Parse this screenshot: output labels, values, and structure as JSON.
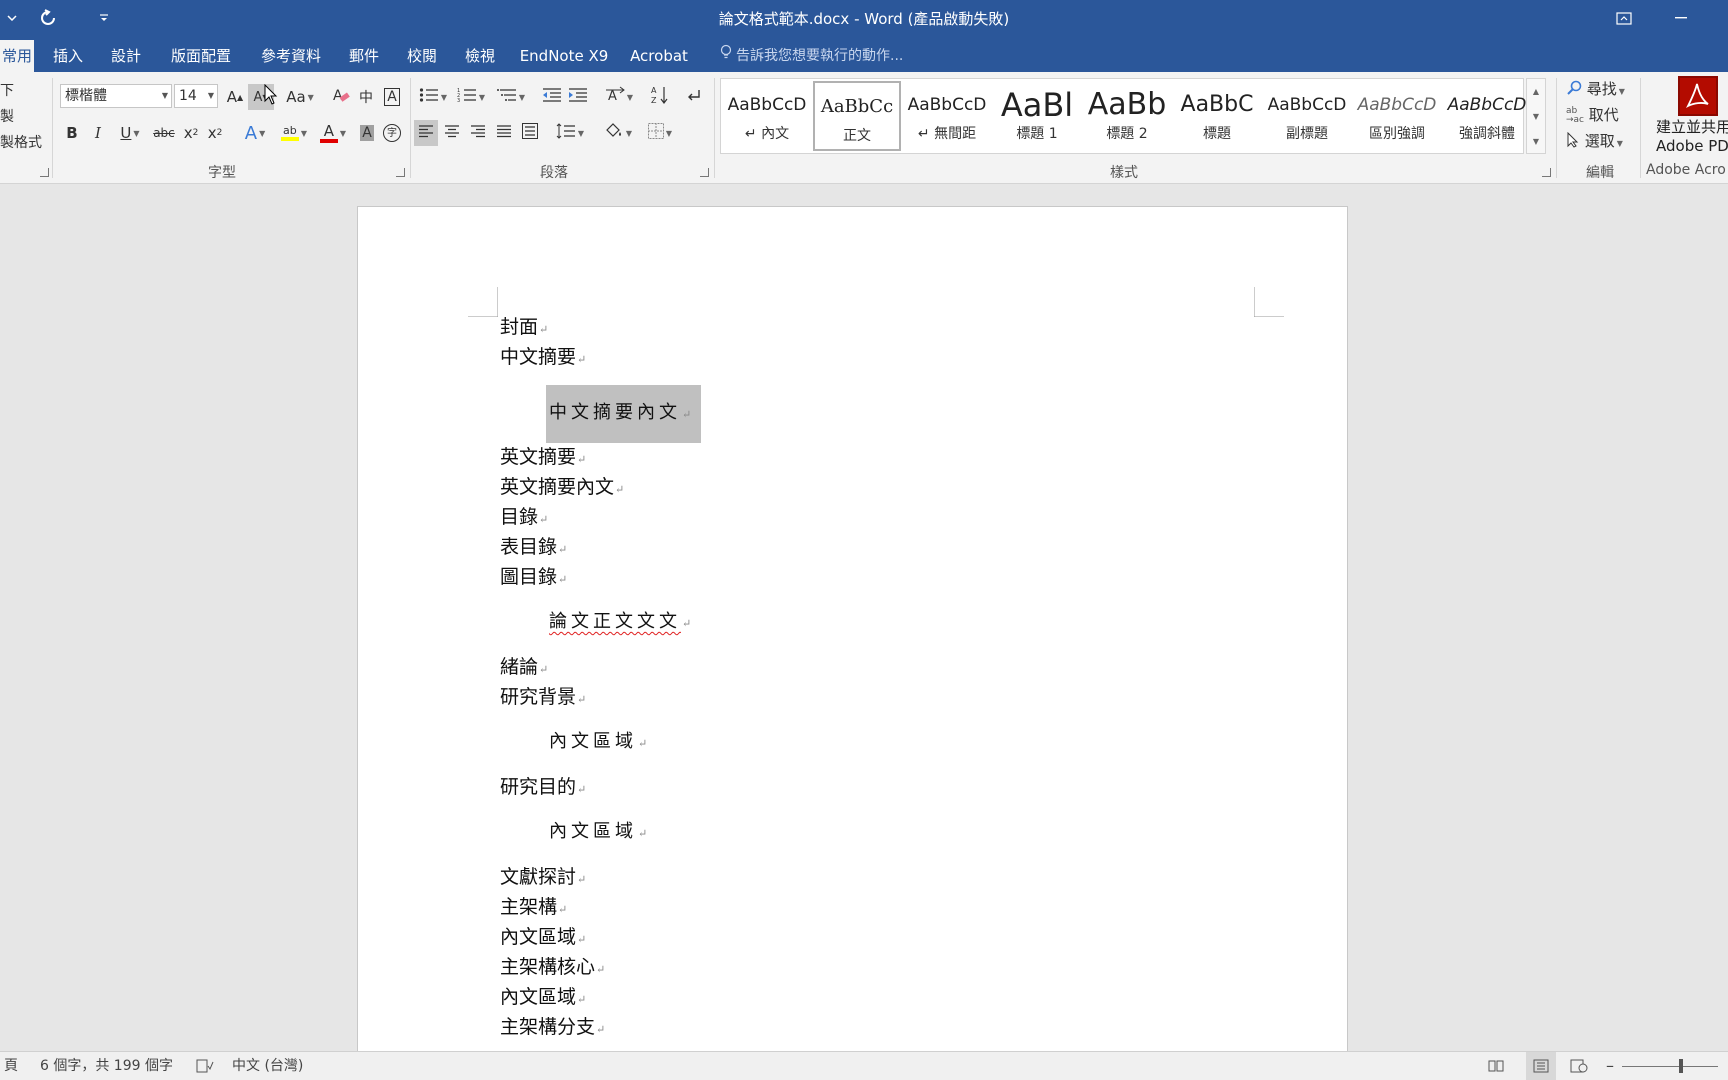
{
  "window": {
    "title": "論文格式範本.docx - Word (產品啟動失敗)"
  },
  "quick_access": {
    "dropdown_icon": "chevron-down-icon",
    "redo_icon": "redo-icon",
    "customize_icon": "customize-toolbar-icon"
  },
  "tabs": [
    {
      "label": "常用"
    },
    {
      "label": "插入"
    },
    {
      "label": "設計"
    },
    {
      "label": "版面配置"
    },
    {
      "label": "參考資料"
    },
    {
      "label": "郵件"
    },
    {
      "label": "校閱"
    },
    {
      "label": "檢視"
    },
    {
      "label": "EndNote X9"
    },
    {
      "label": "Acrobat"
    }
  ],
  "tell_me": "告訴我您想要執行的動作...",
  "clipboard": {
    "items": [
      "下",
      "製",
      "製格式"
    ]
  },
  "font_group": {
    "label": "字型",
    "font_name": "標楷體",
    "font_size": "14",
    "grow": "A",
    "shrink": "A",
    "change_case": "Aa",
    "phonetic": "中",
    "char_border": "A",
    "bold": "B",
    "italic": "I",
    "underline": "U",
    "strike": "abc",
    "subscript": "x",
    "superscript": "x",
    "text_effects": "A",
    "highlight": "ab",
    "font_color": "A",
    "char_shading": "A",
    "enclose": "字"
  },
  "paragraph_group": {
    "label": "段落"
  },
  "styles_group": {
    "label": "樣式",
    "items": [
      {
        "sample": "AaBbCcD",
        "name": "↵ 內文"
      },
      {
        "sample": "AaBbCc",
        "name": "正文"
      },
      {
        "sample": "AaBbCcD",
        "name": "↵ 無間距"
      },
      {
        "sample": "AaBl",
        "name": "標題 1"
      },
      {
        "sample": "AaBb",
        "name": "標題 2"
      },
      {
        "sample": "AaBbC",
        "name": "標題"
      },
      {
        "sample": "AaBbCcD",
        "name": "副標題"
      },
      {
        "sample": "AaBbCcD",
        "name": "區別強調"
      },
      {
        "sample": "AaBbCcD",
        "name": "強調斜體"
      }
    ]
  },
  "editing_group": {
    "label": "編輯",
    "find": "尋找",
    "replace": "取代",
    "select": "選取"
  },
  "acrobat_group": {
    "label": "Adobe Acro",
    "button_line1": "建立並共用",
    "button_line2": "Adobe PD"
  },
  "document": {
    "pilcrow": "↵",
    "lines": [
      {
        "text": "封面",
        "indent": false
      },
      {
        "text": "中文摘要",
        "indent": false
      },
      {
        "text": "中文摘要內文",
        "indent": true
      },
      {
        "text": "英文摘要",
        "indent": false
      },
      {
        "text": "英文摘要內文",
        "indent": false
      },
      {
        "text": "目錄",
        "indent": false
      },
      {
        "text": "表目錄",
        "indent": false
      },
      {
        "text": "圖目錄",
        "indent": false
      },
      {
        "text": "論文正文文文",
        "indent": true
      },
      {
        "text": "緒論",
        "indent": false
      },
      {
        "text": "研究背景",
        "indent": false
      },
      {
        "text": "內文區域",
        "indent": true
      },
      {
        "text": "研究目的",
        "indent": false
      },
      {
        "text": "內文區域",
        "indent": true
      },
      {
        "text": "文獻探討",
        "indent": false
      },
      {
        "text": "主架構",
        "indent": false
      },
      {
        "text": "內文區域",
        "indent": false
      },
      {
        "text": "主架構核心",
        "indent": false
      },
      {
        "text": "內文區域",
        "indent": false
      },
      {
        "text": "主架構分支",
        "indent": false
      }
    ]
  },
  "statusbar": {
    "page": "頁",
    "word_count": "6 個字，共 199 個字",
    "language": "中文 (台灣)"
  },
  "colors": {
    "accent": "#2b579a",
    "font_color_bar": "#e00000",
    "highlight_bar": "#ffff00"
  }
}
